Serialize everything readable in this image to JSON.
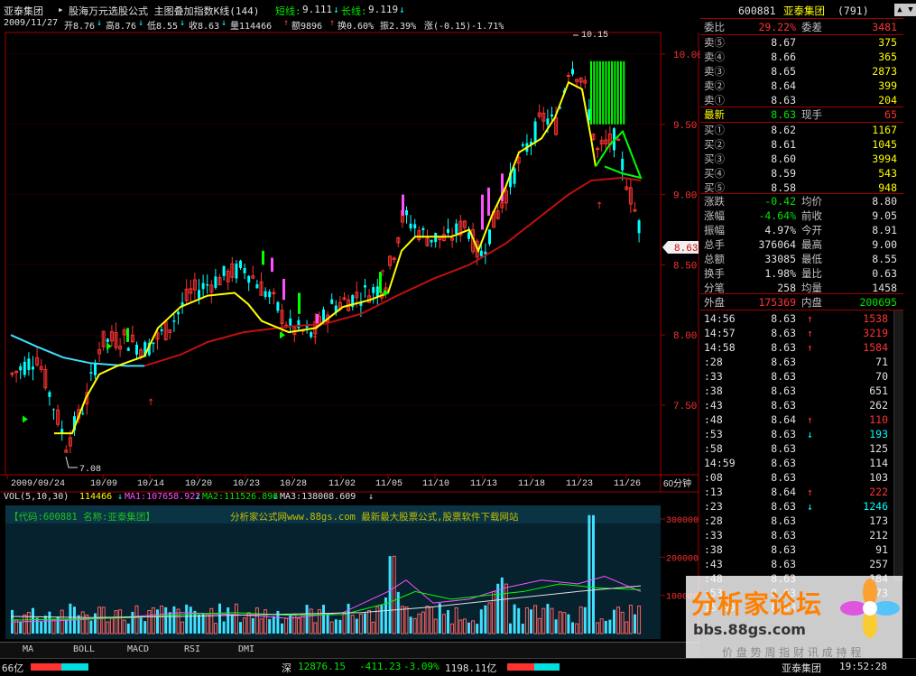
{
  "header": {
    "stock_name": "亚泰集团",
    "formula_title": "股海万元选股公式 主图叠加指数K线(144)",
    "short_line_label": "短线:",
    "short_line_value": "9.111",
    "long_line_label": "长线:",
    "long_line_value": "9.119",
    "date": "2009/11/27",
    "open": "开8.76",
    "high": "高8.76",
    "low": "低8.55",
    "close": "收8.63",
    "volume": "量114466",
    "amount": "额9896",
    "turnover": "换0.60%",
    "amplitude": "振2.39%",
    "change": "涨(-0.15)-1.71%"
  },
  "chart_data": {
    "type": "candlestick",
    "y_ticks": [
      "10.00",
      "9.50",
      "9.00",
      "8.50",
      "8.00",
      "7.50"
    ],
    "y_tick_values": [
      10.0,
      9.5,
      9.0,
      8.5,
      8.0,
      7.5
    ],
    "ylim": [
      7.08,
      10.26
    ],
    "x_ticks": [
      "2009/09/24",
      "10/09",
      "10/14",
      "10/20",
      "10/23",
      "10/28",
      "11/02",
      "11/05",
      "11/10",
      "11/13",
      "11/18",
      "11/23",
      "11/26"
    ],
    "period_label": "60分钟",
    "high_label": "10.15",
    "low_label": "7.08",
    "current_price_tag": "8.63",
    "colors": {
      "up": "#ff3232",
      "down": "#00ffff",
      "ma_short": "#ffff00",
      "ma_long": "#c01010",
      "ma_cyan": "#40e0ff",
      "signal_green": "#00ff00"
    }
  },
  "volume": {
    "legend_label": "VOL(5,10,30)",
    "legend_value": "114466",
    "ma1": "MA1:107658.922",
    "ma2": "MA2:111526.898",
    "ma3": "MA3:138008.609",
    "code_banner": "【代码:600881 名称:亚泰集团】",
    "site_banner": "分析家公式网www.88gs.com 最新最大股票公式,股票软件下载网站",
    "y_ticks": [
      "300000",
      "200000",
      "100000"
    ]
  },
  "tabs": [
    "MA",
    "BOLL",
    "MACD",
    "RSI",
    "DMI"
  ],
  "right_panel": {
    "code": "600881",
    "name": "亚泰集团",
    "seq": "(791)",
    "ratio_label": "委比",
    "ratio_value": "29.22%",
    "diff_label": "委差",
    "diff_value": "3481",
    "asks": [
      {
        "label": "卖⑤",
        "price": "8.67",
        "vol": "375"
      },
      {
        "label": "卖④",
        "price": "8.66",
        "vol": "365"
      },
      {
        "label": "卖③",
        "price": "8.65",
        "vol": "2873"
      },
      {
        "label": "卖②",
        "price": "8.64",
        "vol": "399"
      },
      {
        "label": "卖①",
        "price": "8.63",
        "vol": "204"
      }
    ],
    "last_label": "最新",
    "last_price": "8.63",
    "hand_label": "现手",
    "hand_value": "65",
    "bids": [
      {
        "label": "买①",
        "price": "8.62",
        "vol": "1167"
      },
      {
        "label": "买②",
        "price": "8.61",
        "vol": "1045"
      },
      {
        "label": "买③",
        "price": "8.60",
        "vol": "3994"
      },
      {
        "label": "买④",
        "price": "8.59",
        "vol": "543"
      },
      {
        "label": "买⑤",
        "price": "8.58",
        "vol": "948"
      }
    ],
    "stats": [
      {
        "l1": "涨跌",
        "v1": "-0.42",
        "l2": "均价",
        "v2": "8.80"
      },
      {
        "l1": "涨幅",
        "v1": "-4.64%",
        "l2": "前收",
        "v2": "9.05"
      },
      {
        "l1": "振幅",
        "v1": "4.97%",
        "l2": "今开",
        "v2": "8.91"
      },
      {
        "l1": "总手",
        "v1": "376064",
        "l2": "最高",
        "v2": "9.00"
      },
      {
        "l1": "总额",
        "v1": "33085",
        "l2": "最低",
        "v2": "8.55"
      },
      {
        "l1": "换手",
        "v1": "1.98%",
        "l2": "量比",
        "v2": "0.63"
      },
      {
        "l1": "分笔",
        "v1": "258",
        "l2": "均量",
        "v2": "1458"
      }
    ],
    "outer_label": "外盘",
    "outer_value": "175369",
    "inner_label": "内盘",
    "inner_value": "200695",
    "ticks": [
      {
        "t": "14:56",
        "p": "8.63",
        "a": "↑",
        "v": "1538"
      },
      {
        "t": "14:57",
        "p": "8.63",
        "a": "↑",
        "v": "3219"
      },
      {
        "t": "14:58",
        "p": "8.63",
        "a": "↑",
        "v": "1584"
      },
      {
        "t": ":28",
        "p": "8.63",
        "a": "",
        "v": "71"
      },
      {
        "t": ":33",
        "p": "8.63",
        "a": "",
        "v": "70"
      },
      {
        "t": ":38",
        "p": "8.63",
        "a": "",
        "v": "651"
      },
      {
        "t": ":43",
        "p": "8.63",
        "a": "",
        "v": "262"
      },
      {
        "t": ":48",
        "p": "8.64",
        "a": "↑",
        "v": "110"
      },
      {
        "t": ":53",
        "p": "8.63",
        "a": "↓",
        "v": "193"
      },
      {
        "t": ":58",
        "p": "8.63",
        "a": "",
        "v": "125"
      },
      {
        "t": "14:59",
        "p": "8.63",
        "a": "",
        "v": "114"
      },
      {
        "t": ":08",
        "p": "8.63",
        "a": "",
        "v": "103"
      },
      {
        "t": ":13",
        "p": "8.64",
        "a": "↑",
        "v": "222"
      },
      {
        "t": ":23",
        "p": "8.63",
        "a": "↓",
        "v": "1246"
      },
      {
        "t": ":28",
        "p": "8.63",
        "a": "",
        "v": "173"
      },
      {
        "t": ":33",
        "p": "8.63",
        "a": "",
        "v": "212"
      },
      {
        "t": ":38",
        "p": "8.63",
        "a": "",
        "v": "91"
      },
      {
        "t": ":43",
        "p": "8.63",
        "a": "",
        "v": "257"
      },
      {
        "t": ":48",
        "p": "8.63",
        "a": "",
        "v": "184"
      },
      {
        "t": ":53",
        "p": "8.63",
        "a": "",
        "v": "73"
      },
      {
        "t": "15:00",
        "p": "8.63",
        "a": "",
        "v": "65"
      }
    ]
  },
  "statusbar": {
    "left": "66亿",
    "index_label": "深",
    "index_value": "12876.15",
    "index_change": "-411.23",
    "index_pct": "-3.09%",
    "index_amount": "1198.11亿",
    "stock": "亚泰集团",
    "time": "19:52:28"
  },
  "watermark": {
    "title": "分析家论坛",
    "url": "bbs.88gs.com",
    "slogan": "价 盘 势 周 指 财 讯 成 持 程"
  }
}
